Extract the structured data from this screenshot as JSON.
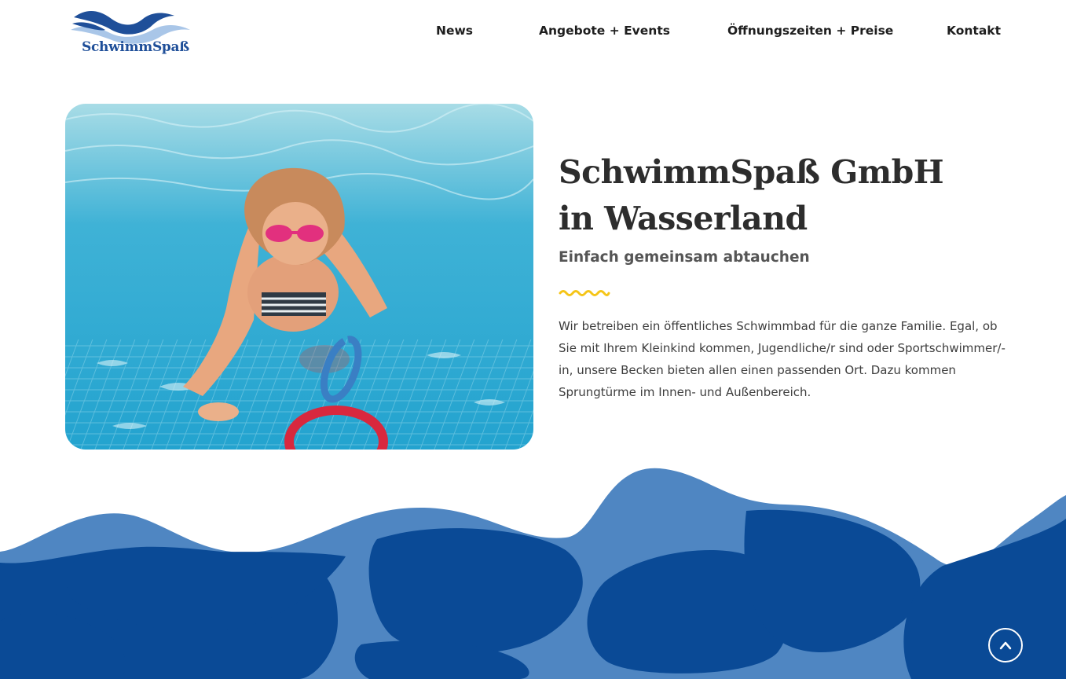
{
  "logo": {
    "text": "SchwimmSpaß",
    "icon": "waves-logo-icon"
  },
  "nav": {
    "items": [
      {
        "label": "News"
      },
      {
        "label": "Angebote + Events"
      },
      {
        "label": "Öffnungszeiten + Preise"
      },
      {
        "label": "Kontakt"
      }
    ]
  },
  "hero": {
    "image_icon": "swimming-girl-photo",
    "title_line1": "SchwimmSpaß GmbH",
    "title_line2": "in Wasserland",
    "subtitle": "Einfach gemeinsam abtauchen",
    "intro": "Wir betreiben ein öffentliches Schwimmbad für die ganze Familie. Egal, ob Sie mit Ihrem Kleinkind kommen, Jugendliche/r sind oder Sportschwimmer/-in, unsere Becken bieten allen einen passenden Ort. Dazu kommen Sprungtürme im Innen- und Außenbereich."
  },
  "scroll_top": {
    "icon": "chevron-up-icon"
  },
  "colors": {
    "brand_blue": "#0a4a96",
    "light_blue": "#4f86c2",
    "accent_yellow": "#f5c518",
    "logo_light": "#a9c6e8"
  }
}
